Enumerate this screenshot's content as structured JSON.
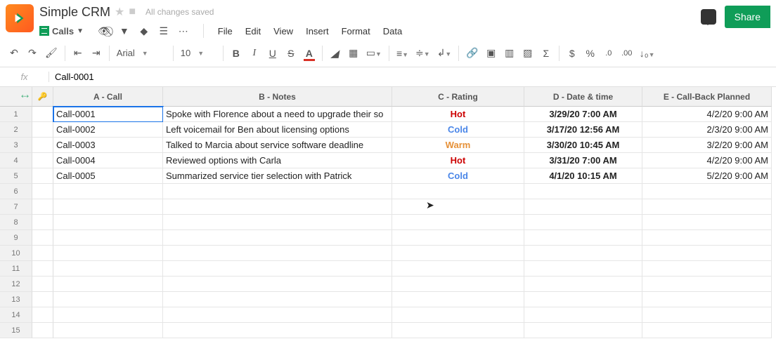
{
  "doc": {
    "title": "Simple CRM",
    "save_status": "All changes saved",
    "sheet_name": "Calls"
  },
  "menus": {
    "file": "File",
    "edit": "Edit",
    "view": "View",
    "insert": "Insert",
    "format": "Format",
    "data": "Data"
  },
  "share_label": "Share",
  "toolbar": {
    "font": "Arial",
    "size": "10",
    "currency": "$",
    "percent": "%",
    "dec_dec": ".0",
    "dec_inc": ".00"
  },
  "formula": {
    "fx": "fx",
    "value": "Call-0001"
  },
  "columns": {
    "a": "A - Call",
    "b": "B - Notes",
    "c": "C - Rating",
    "d": "D - Date & time",
    "e": "E - Call-Back Planned"
  },
  "rows": [
    {
      "call": "Call-0001",
      "notes": "Spoke with Florence about a need to upgrade their so",
      "rating": "Hot",
      "datetime": "3/29/20 7:00 AM",
      "callback": "4/2/20 9:00 AM"
    },
    {
      "call": "Call-0002",
      "notes": "Left voicemail for Ben about licensing options",
      "rating": "Cold",
      "datetime": "3/17/20 12:56 AM",
      "callback": "2/3/20 9:00 AM"
    },
    {
      "call": "Call-0003",
      "notes": "Talked to Marcia about service software deadline",
      "rating": "Warm",
      "datetime": "3/30/20 10:45 AM",
      "callback": "3/2/20 9:00 AM"
    },
    {
      "call": "Call-0004",
      "notes": "Reviewed options with Carla",
      "rating": "Hot",
      "datetime": "3/31/20 7:00 AM",
      "callback": "4/2/20 9:00 AM"
    },
    {
      "call": "Call-0005",
      "notes": "Summarized service tier selection with Patrick",
      "rating": "Cold",
      "datetime": "4/1/20 10:15 AM",
      "callback": "5/2/20 9:00 AM"
    }
  ],
  "empty_rows": 10,
  "chart_data": {
    "type": "table",
    "title": "Calls",
    "headers": [
      "Call",
      "Notes",
      "Rating",
      "Date & time",
      "Call-Back Planned"
    ],
    "data": [
      [
        "Call-0001",
        "Spoke with Florence about a need to upgrade their so",
        "Hot",
        "3/29/20 7:00 AM",
        "4/2/20 9:00 AM"
      ],
      [
        "Call-0002",
        "Left voicemail for Ben about licensing options",
        "Cold",
        "3/17/20 12:56 AM",
        "2/3/20 9:00 AM"
      ],
      [
        "Call-0003",
        "Talked to Marcia about service software deadline",
        "Warm",
        "3/30/20 10:45 AM",
        "3/2/20 9:00 AM"
      ],
      [
        "Call-0004",
        "Reviewed options with Carla",
        "Hot",
        "3/31/20 7:00 AM",
        "4/2/20 9:00 AM"
      ],
      [
        "Call-0005",
        "Summarized service tier selection with Patrick",
        "Cold",
        "4/1/20 10:15 AM",
        "5/2/20 9:00 AM"
      ]
    ]
  }
}
